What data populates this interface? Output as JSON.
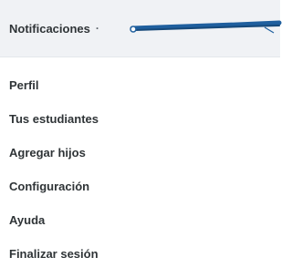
{
  "header": {
    "notifications_label": "Notificaciones",
    "separator": "·"
  },
  "annotation": {
    "color": "#1f5f9e",
    "icon": "pen-stroke-annotation"
  },
  "menu": {
    "items": [
      {
        "label": "Perfil"
      },
      {
        "label": "Tus estudiantes"
      },
      {
        "label": "Agregar hijos"
      },
      {
        "label": "Configuración"
      },
      {
        "label": "Ayuda"
      },
      {
        "label": "Finalizar sesión"
      }
    ]
  }
}
